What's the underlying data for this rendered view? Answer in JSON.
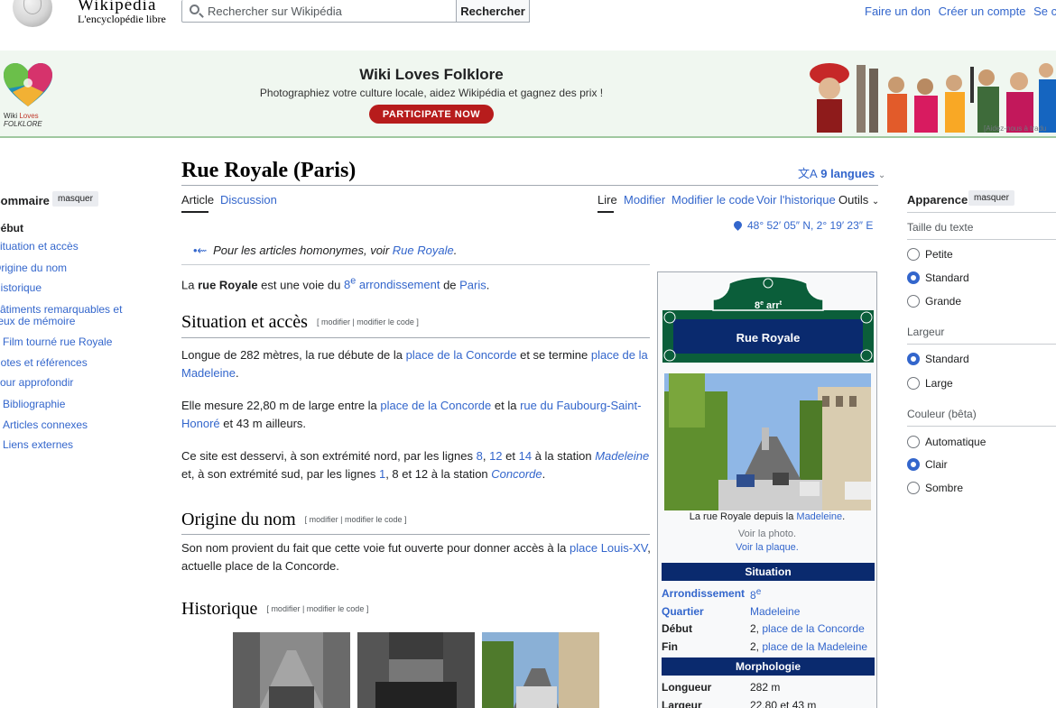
{
  "header": {
    "wordmark": "Wikipédia",
    "tagline": "L'encyclopédie libre",
    "search_placeholder": "Rechercher sur Wikipédia",
    "search_button": "Rechercher",
    "user_links": [
      "Faire un don",
      "Créer un compte",
      "Se conne"
    ]
  },
  "banner": {
    "logo_text_1": "Wiki ",
    "logo_text_red": "Loves",
    "logo_text_2": "FOLKLORE",
    "title": "Wiki Loves Folklore",
    "subtitle": "Photographiez votre culture locale, aidez Wikipédia et gagnez des prix !",
    "cta": "PARTICIPATE NOW",
    "help": "[Aidez-nous à tradu"
  },
  "toc": {
    "title": "Sommaire",
    "hide": "masquer",
    "items": [
      {
        "label": "Début"
      },
      {
        "label": "Situation et accès"
      },
      {
        "label": "Origine du nom"
      },
      {
        "label": "Historique"
      },
      {
        "label": "Bâtiments remarquables et lieux de mémoire"
      },
      {
        "label": "Film tourné rue Royale"
      },
      {
        "label": "Notes et références"
      },
      {
        "label": "Pour approfondir"
      },
      {
        "label": "Bibliographie"
      },
      {
        "label": "Articles connexes"
      },
      {
        "label": "Liens externes"
      }
    ]
  },
  "article": {
    "title": "Rue Royale (Paris)",
    "languages": "9 langues",
    "tabs": {
      "article": "Article",
      "discussion": "Discussion",
      "lire": "Lire",
      "modifier": "Modifier",
      "modifier_code": "Modifier le code",
      "historique": "Voir l'historique",
      "outils": "Outils"
    },
    "coordinates": "48° 52′ 05″ N, 2° 19′ 23″ E",
    "hatnote_prefix": "Pour les articles homonymes, voir ",
    "hatnote_link": "Rue Royale",
    "hatnote_suffix": ".",
    "intro": {
      "a": "La ",
      "b": "rue Royale",
      "c": " est une voie du ",
      "d": "8",
      "d_sup": "e",
      "e": " arrondissement",
      "f": " de ",
      "g": "Paris",
      "h": "."
    },
    "edit_links": "[ modifier | modifier le code ]",
    "sections": {
      "situation": "Situation et accès",
      "origine": "Origine du nom",
      "historique": "Historique"
    },
    "p_situation_1": {
      "a": "Longue de 282 mètres, la rue débute de la ",
      "b": "place de la Concorde",
      "c": " et se termine ",
      "d": "place de la Madeleine",
      "e": "."
    },
    "p_situation_2": {
      "a": "Elle mesure 22,80 m de large entre la ",
      "b": "place de la Concorde",
      "c": " et la ",
      "d": "rue du Faubourg-Saint-Honoré",
      "e": " et 43 m ailleurs."
    },
    "p_situation_3": {
      "a": "Ce site est desservi, à son extrémité nord, par les lignes ",
      "b": "8",
      "c": ", ",
      "d": "12",
      "e": " et ",
      "f": "14",
      "g": " à la station ",
      "h": "Madeleine",
      "i": " et, à son extrémité sud, par les lignes ",
      "j": "1",
      "k": ", 8 et 12 à la station ",
      "l": "Concorde",
      "m": "."
    },
    "p_origine": {
      "a": "Son nom provient du fait que cette voie fut ouverte pour donner accès à la ",
      "b": "place Louis-XV",
      "c": ", actuelle place de la Concorde."
    }
  },
  "infobox": {
    "plaque_arr": "8",
    "plaque_arr_sup": "e",
    "plaque_arr_suffix": " arr",
    "plaque_arr_sup2": "t",
    "plaque_name": "Rue Royale",
    "caption_prefix": "La rue Royale depuis la ",
    "caption_link": "Madeleine",
    "caption_suffix": ".",
    "voir_photo": "Voir la photo.",
    "voir_plaque": "Voir la plaque.",
    "situation_header": "Situation",
    "morphologie_header": "Morphologie",
    "rows": {
      "arrondissement_label": "Arrondissement",
      "arrondissement_value": "8",
      "arrondissement_sup": "e",
      "quartier_label": "Quartier",
      "quartier_value": "Madeleine",
      "debut_label": "Début",
      "debut_num": "2, ",
      "debut_value": "place de la Concorde",
      "fin_label": "Fin",
      "fin_num": "2, ",
      "fin_value": "place de la Madeleine",
      "longueur_label": "Longueur",
      "longueur_value": "282 m",
      "largeur_label": "Largeur",
      "largeur_value": "22,80 et 43 m"
    }
  },
  "appearance": {
    "title": "Apparence",
    "hide": "masquer",
    "text_size_heading": "Taille du texte",
    "text_size": [
      "Petite",
      "Standard",
      "Grande"
    ],
    "text_size_selected": 1,
    "width_heading": "Largeur",
    "width": [
      "Standard",
      "Large"
    ],
    "width_selected": 0,
    "color_heading": "Couleur (bêta)",
    "color": [
      "Automatique",
      "Clair",
      "Sombre"
    ],
    "color_selected": 1
  },
  "colors": {
    "link": "#3366cc",
    "infobox_header": "#0a2a6e",
    "plaque": "#0b5e3a",
    "banner_bg": "#f0f7f0",
    "cta": "#b71c1c"
  }
}
